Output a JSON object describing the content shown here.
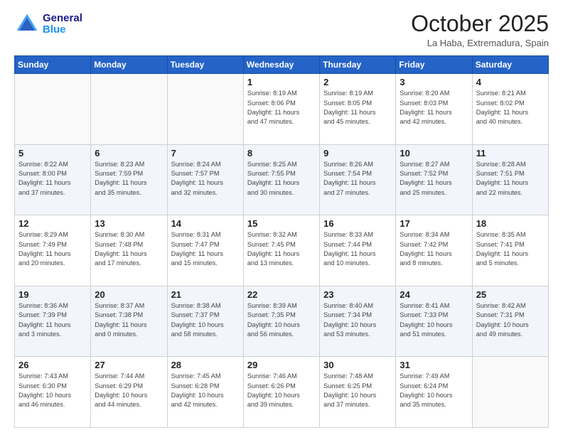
{
  "header": {
    "logo_general": "General",
    "logo_blue": "Blue",
    "month": "October 2025",
    "location": "La Haba, Extremadura, Spain"
  },
  "weekdays": [
    "Sunday",
    "Monday",
    "Tuesday",
    "Wednesday",
    "Thursday",
    "Friday",
    "Saturday"
  ],
  "weeks": [
    [
      {
        "day": "",
        "info": ""
      },
      {
        "day": "",
        "info": ""
      },
      {
        "day": "",
        "info": ""
      },
      {
        "day": "1",
        "info": "Sunrise: 8:19 AM\nSunset: 8:06 PM\nDaylight: 11 hours\nand 47 minutes."
      },
      {
        "day": "2",
        "info": "Sunrise: 8:19 AM\nSunset: 8:05 PM\nDaylight: 11 hours\nand 45 minutes."
      },
      {
        "day": "3",
        "info": "Sunrise: 8:20 AM\nSunset: 8:03 PM\nDaylight: 11 hours\nand 42 minutes."
      },
      {
        "day": "4",
        "info": "Sunrise: 8:21 AM\nSunset: 8:02 PM\nDaylight: 11 hours\nand 40 minutes."
      }
    ],
    [
      {
        "day": "5",
        "info": "Sunrise: 8:22 AM\nSunset: 8:00 PM\nDaylight: 11 hours\nand 37 minutes."
      },
      {
        "day": "6",
        "info": "Sunrise: 8:23 AM\nSunset: 7:59 PM\nDaylight: 11 hours\nand 35 minutes."
      },
      {
        "day": "7",
        "info": "Sunrise: 8:24 AM\nSunset: 7:57 PM\nDaylight: 11 hours\nand 32 minutes."
      },
      {
        "day": "8",
        "info": "Sunrise: 8:25 AM\nSunset: 7:55 PM\nDaylight: 11 hours\nand 30 minutes."
      },
      {
        "day": "9",
        "info": "Sunrise: 8:26 AM\nSunset: 7:54 PM\nDaylight: 11 hours\nand 27 minutes."
      },
      {
        "day": "10",
        "info": "Sunrise: 8:27 AM\nSunset: 7:52 PM\nDaylight: 11 hours\nand 25 minutes."
      },
      {
        "day": "11",
        "info": "Sunrise: 8:28 AM\nSunset: 7:51 PM\nDaylight: 11 hours\nand 22 minutes."
      }
    ],
    [
      {
        "day": "12",
        "info": "Sunrise: 8:29 AM\nSunset: 7:49 PM\nDaylight: 11 hours\nand 20 minutes."
      },
      {
        "day": "13",
        "info": "Sunrise: 8:30 AM\nSunset: 7:48 PM\nDaylight: 11 hours\nand 17 minutes."
      },
      {
        "day": "14",
        "info": "Sunrise: 8:31 AM\nSunset: 7:47 PM\nDaylight: 11 hours\nand 15 minutes."
      },
      {
        "day": "15",
        "info": "Sunrise: 8:32 AM\nSunset: 7:45 PM\nDaylight: 11 hours\nand 13 minutes."
      },
      {
        "day": "16",
        "info": "Sunrise: 8:33 AM\nSunset: 7:44 PM\nDaylight: 11 hours\nand 10 minutes."
      },
      {
        "day": "17",
        "info": "Sunrise: 8:34 AM\nSunset: 7:42 PM\nDaylight: 11 hours\nand 8 minutes."
      },
      {
        "day": "18",
        "info": "Sunrise: 8:35 AM\nSunset: 7:41 PM\nDaylight: 11 hours\nand 5 minutes."
      }
    ],
    [
      {
        "day": "19",
        "info": "Sunrise: 8:36 AM\nSunset: 7:39 PM\nDaylight: 11 hours\nand 3 minutes."
      },
      {
        "day": "20",
        "info": "Sunrise: 8:37 AM\nSunset: 7:38 PM\nDaylight: 11 hours\nand 0 minutes."
      },
      {
        "day": "21",
        "info": "Sunrise: 8:38 AM\nSunset: 7:37 PM\nDaylight: 10 hours\nand 58 minutes."
      },
      {
        "day": "22",
        "info": "Sunrise: 8:39 AM\nSunset: 7:35 PM\nDaylight: 10 hours\nand 56 minutes."
      },
      {
        "day": "23",
        "info": "Sunrise: 8:40 AM\nSunset: 7:34 PM\nDaylight: 10 hours\nand 53 minutes."
      },
      {
        "day": "24",
        "info": "Sunrise: 8:41 AM\nSunset: 7:33 PM\nDaylight: 10 hours\nand 51 minutes."
      },
      {
        "day": "25",
        "info": "Sunrise: 8:42 AM\nSunset: 7:31 PM\nDaylight: 10 hours\nand 49 minutes."
      }
    ],
    [
      {
        "day": "26",
        "info": "Sunrise: 7:43 AM\nSunset: 6:30 PM\nDaylight: 10 hours\nand 46 minutes."
      },
      {
        "day": "27",
        "info": "Sunrise: 7:44 AM\nSunset: 6:29 PM\nDaylight: 10 hours\nand 44 minutes."
      },
      {
        "day": "28",
        "info": "Sunrise: 7:45 AM\nSunset: 6:28 PM\nDaylight: 10 hours\nand 42 minutes."
      },
      {
        "day": "29",
        "info": "Sunrise: 7:46 AM\nSunset: 6:26 PM\nDaylight: 10 hours\nand 39 minutes."
      },
      {
        "day": "30",
        "info": "Sunrise: 7:48 AM\nSunset: 6:25 PM\nDaylight: 10 hours\nand 37 minutes."
      },
      {
        "day": "31",
        "info": "Sunrise: 7:49 AM\nSunset: 6:24 PM\nDaylight: 10 hours\nand 35 minutes."
      },
      {
        "day": "",
        "info": ""
      }
    ]
  ]
}
